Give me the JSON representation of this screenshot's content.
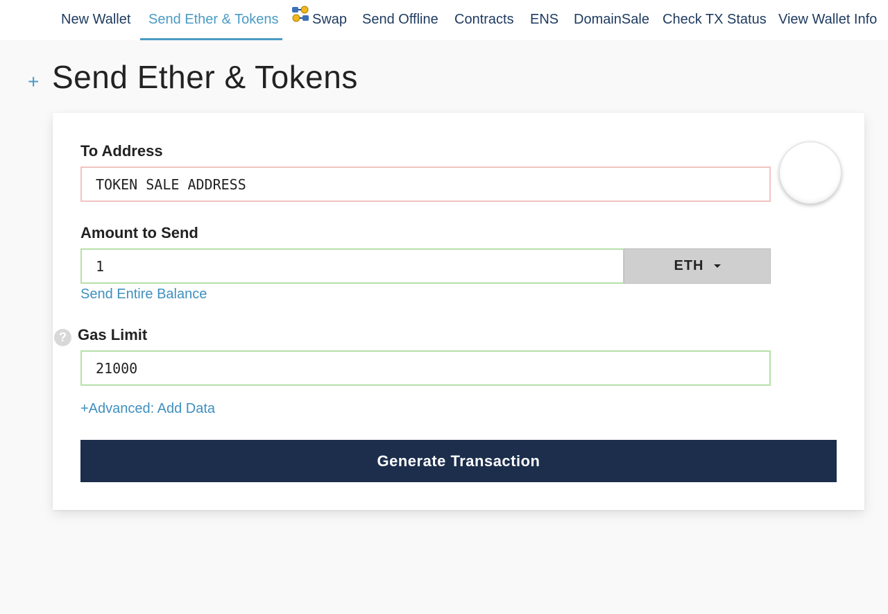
{
  "nav": {
    "items": [
      {
        "label": "New Wallet"
      },
      {
        "label": "Send Ether & Tokens",
        "active": true
      },
      {
        "label": "Swap",
        "icon": "swap-icon"
      },
      {
        "label": "Send Offline"
      },
      {
        "label": "Contracts"
      },
      {
        "label": "ENS"
      },
      {
        "label": "DomainSale"
      },
      {
        "label": "Check TX Status"
      },
      {
        "label": "View Wallet Info"
      }
    ]
  },
  "header": {
    "toggle": "+",
    "title": "Send Ether & Tokens"
  },
  "form": {
    "to_address": {
      "label": "To Address",
      "value": "TOKEN SALE ADDRESS",
      "status": "invalid"
    },
    "amount": {
      "label": "Amount to Send",
      "value": "1",
      "unit": "ETH",
      "send_entire_balance": "Send Entire Balance"
    },
    "gas_limit": {
      "label": "Gas Limit",
      "value": "21000",
      "help": "?"
    },
    "advanced_link": "+Advanced: Add Data",
    "generate_button": "Generate Transaction"
  },
  "colors": {
    "accent": "#4a9bc4",
    "navy": "#1c2e4c",
    "valid_border": "#b6e0a8",
    "invalid_border": "#f2c2c2"
  }
}
